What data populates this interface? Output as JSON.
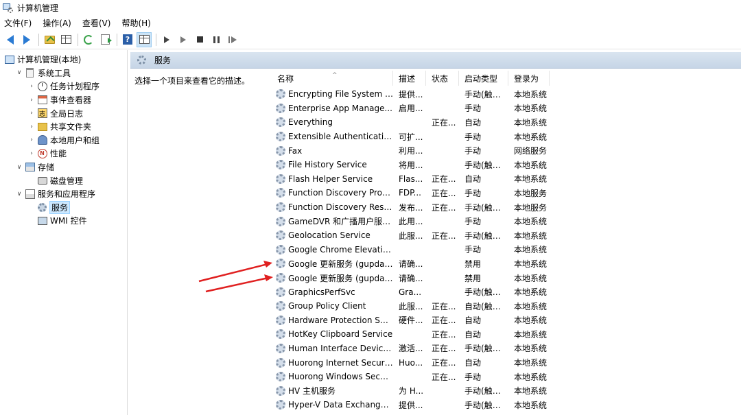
{
  "window": {
    "title": "计算机管理"
  },
  "menu": [
    "文件(F)",
    "操作(A)",
    "查看(V)",
    "帮助(H)"
  ],
  "toolbar": {
    "icons": [
      "back-icon",
      "forward-icon",
      "up-folder-icon",
      "show-tree-icon",
      "refresh-icon",
      "export-icon",
      "help-icon",
      "console-tree-icon",
      "start-icon",
      "start-alt-icon",
      "stop-icon",
      "pause-icon",
      "resume-icon"
    ]
  },
  "tree": [
    {
      "label": "计算机管理(本地)",
      "level": 0,
      "twisty": "",
      "icon": "computer-icon"
    },
    {
      "label": "系统工具",
      "level": 1,
      "twisty": "v",
      "icon": "tools-icon"
    },
    {
      "label": "任务计划程序",
      "level": 2,
      "twisty": ">",
      "icon": "clock-icon"
    },
    {
      "label": "事件查看器",
      "level": 2,
      "twisty": ">",
      "icon": "event-viewer-icon"
    },
    {
      "label": "全局日志",
      "level": 2,
      "twisty": ">",
      "icon": "log-icon"
    },
    {
      "label": "共享文件夹",
      "level": 2,
      "twisty": ">",
      "icon": "shared-folder-icon"
    },
    {
      "label": "本地用户和组",
      "level": 2,
      "twisty": ">",
      "icon": "users-icon"
    },
    {
      "label": "性能",
      "level": 2,
      "twisty": ">",
      "icon": "performance-icon"
    },
    {
      "label": "存储",
      "level": 1,
      "twisty": "v",
      "icon": "storage-icon"
    },
    {
      "label": "磁盘管理",
      "level": 2,
      "twisty": "",
      "icon": "disk-icon"
    },
    {
      "label": "服务和应用程序",
      "level": 1,
      "twisty": "v",
      "icon": "apps-icon"
    },
    {
      "label": "服务",
      "level": 2,
      "twisty": "",
      "icon": "gear-icon",
      "selected": true
    },
    {
      "label": "WMI 控件",
      "level": 2,
      "twisty": "",
      "icon": "wmi-icon"
    }
  ],
  "services_header": {
    "title": "服务"
  },
  "description_pane": {
    "text": "选择一个项目来查看它的描述。"
  },
  "columns": [
    "名称",
    "描述",
    "状态",
    "启动类型",
    "登录为"
  ],
  "services": [
    {
      "name": "Encrypting File System (E...",
      "desc": "提供...",
      "status": "",
      "startup": "手动(触发...",
      "logon": "本地系统"
    },
    {
      "name": "Enterprise App Manage...",
      "desc": "启用...",
      "status": "",
      "startup": "手动",
      "logon": "本地系统"
    },
    {
      "name": "Everything",
      "desc": "",
      "status": "正在...",
      "startup": "自动",
      "logon": "本地系统"
    },
    {
      "name": "Extensible Authentication...",
      "desc": "可扩...",
      "status": "",
      "startup": "手动",
      "logon": "本地系统"
    },
    {
      "name": "Fax",
      "desc": "利用...",
      "status": "",
      "startup": "手动",
      "logon": "网络服务"
    },
    {
      "name": "File History Service",
      "desc": "将用...",
      "status": "",
      "startup": "手动(触发...",
      "logon": "本地系统"
    },
    {
      "name": "Flash Helper Service",
      "desc": "Flas...",
      "status": "正在...",
      "startup": "自动",
      "logon": "本地系统"
    },
    {
      "name": "Function Discovery Provi...",
      "desc": "FDP...",
      "status": "正在...",
      "startup": "手动",
      "logon": "本地服务"
    },
    {
      "name": "Function Discovery Reso...",
      "desc": "发布...",
      "status": "正在...",
      "startup": "手动(触发...",
      "logon": "本地服务"
    },
    {
      "name": "GameDVR 和广播用户服务...",
      "desc": "此用...",
      "status": "",
      "startup": "手动",
      "logon": "本地系统"
    },
    {
      "name": "Geolocation Service",
      "desc": "此服...",
      "status": "正在...",
      "startup": "手动(触发...",
      "logon": "本地系统"
    },
    {
      "name": "Google Chrome Elevatio...",
      "desc": "",
      "status": "",
      "startup": "手动",
      "logon": "本地系统"
    },
    {
      "name": "Google 更新服务 (gupdate)",
      "desc": "请确...",
      "status": "",
      "startup": "禁用",
      "logon": "本地系统"
    },
    {
      "name": "Google 更新服务 (gupdat...",
      "desc": "请确...",
      "status": "",
      "startup": "禁用",
      "logon": "本地系统"
    },
    {
      "name": "GraphicsPerfSvc",
      "desc": "Gra...",
      "status": "",
      "startup": "手动(触发...",
      "logon": "本地系统"
    },
    {
      "name": "Group Policy Client",
      "desc": "此服...",
      "status": "正在...",
      "startup": "自动(触发...",
      "logon": "本地系统"
    },
    {
      "name": "Hardware Protection Ser...",
      "desc": "硬件...",
      "status": "正在...",
      "startup": "自动",
      "logon": "本地系统"
    },
    {
      "name": "HotKey Clipboard Service",
      "desc": "",
      "status": "正在...",
      "startup": "自动",
      "logon": "本地系统"
    },
    {
      "name": "Human Interface Device ...",
      "desc": "激活...",
      "status": "正在...",
      "startup": "手动(触发...",
      "logon": "本地系统"
    },
    {
      "name": "Huorong Internet Securit...",
      "desc": "Huo...",
      "status": "正在...",
      "startup": "自动",
      "logon": "本地系统"
    },
    {
      "name": "Huorong Windows Secur...",
      "desc": "",
      "status": "正在...",
      "startup": "手动",
      "logon": "本地系统"
    },
    {
      "name": "HV 主机服务",
      "desc": "为 H...",
      "status": "",
      "startup": "手动(触发...",
      "logon": "本地系统"
    },
    {
      "name": "Hyper-V Data Exchange ...",
      "desc": "提供...",
      "status": "",
      "startup": "手动(触发...",
      "logon": "本地系统"
    }
  ],
  "annotation_color": "#e02020"
}
